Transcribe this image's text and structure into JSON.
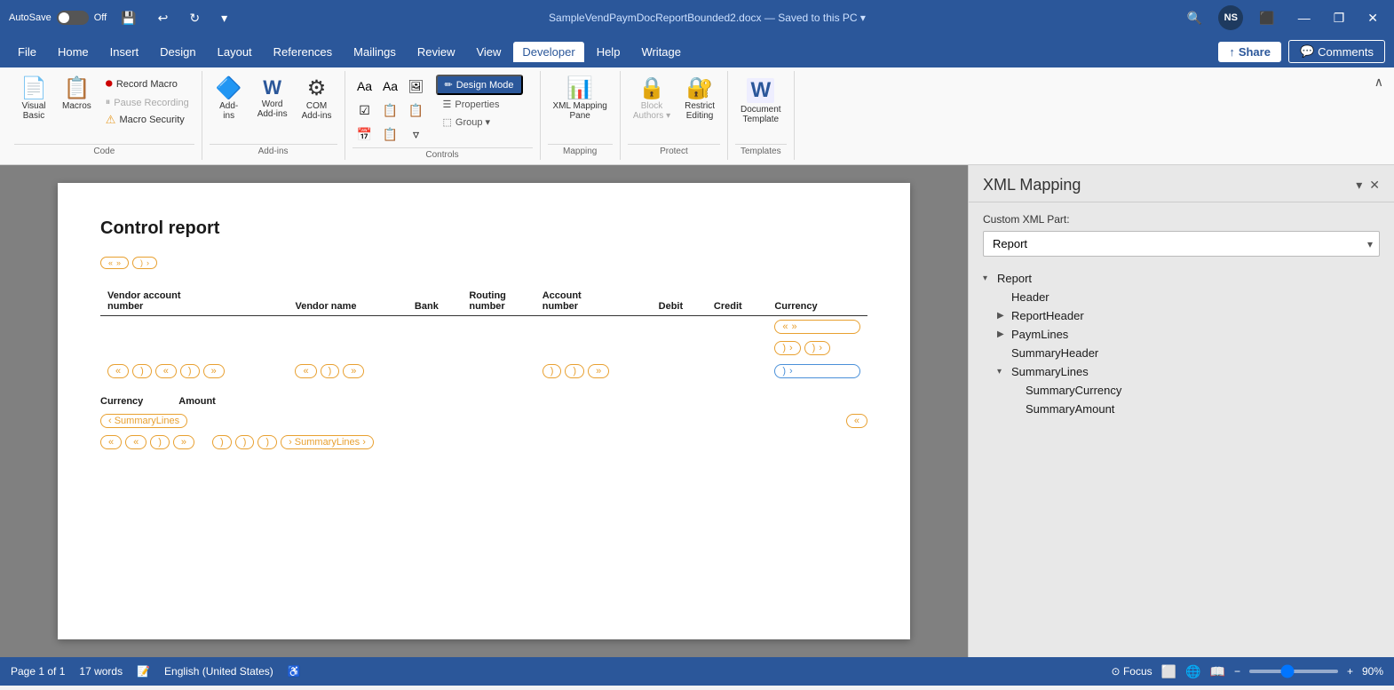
{
  "titlebar": {
    "autosave_label": "AutoSave",
    "autosave_state": "Off",
    "filename": "SampleVendPaymDocReportBounded2.docx",
    "save_status": "Saved to this PC",
    "avatar_initials": "NS",
    "minimize": "—",
    "restore": "❐",
    "close": "✕"
  },
  "menubar": {
    "items": [
      "File",
      "Home",
      "Insert",
      "Design",
      "Layout",
      "References",
      "Mailings",
      "Review",
      "View",
      "Developer",
      "Help",
      "Writage"
    ],
    "active": "Developer",
    "share_label": "Share",
    "comments_label": "Comments"
  },
  "ribbon": {
    "groups": [
      {
        "name": "Code",
        "items": [
          {
            "id": "visual-basic",
            "label": "Visual\nBasic",
            "icon": "📄"
          },
          {
            "id": "macros",
            "label": "Macros",
            "icon": "📋"
          },
          {
            "id": "record-macro",
            "label": "Record Macro"
          },
          {
            "id": "pause-recording",
            "label": "Pause Recording"
          },
          {
            "id": "macro-security",
            "label": "Macro Security"
          }
        ]
      },
      {
        "name": "Add-ins",
        "items": [
          {
            "id": "add-ins",
            "label": "Add-\nins",
            "icon": "🔷"
          },
          {
            "id": "word-add-ins",
            "label": "Word\nAdd-ins",
            "icon": "W"
          },
          {
            "id": "com-add-ins",
            "label": "COM\nAdd-ins",
            "icon": "⚙️"
          }
        ]
      },
      {
        "name": "Controls",
        "items": []
      },
      {
        "name": "Mapping",
        "items": [
          {
            "id": "xml-mapping-pane",
            "label": "XML Mapping\nPane",
            "icon": "📊"
          }
        ]
      },
      {
        "name": "Protect",
        "items": [
          {
            "id": "block-authors",
            "label": "Block\nAuthors",
            "icon": "🔒"
          },
          {
            "id": "restrict-editing",
            "label": "Restrict\nEditing",
            "icon": "🔐"
          }
        ]
      },
      {
        "name": "Templates",
        "items": [
          {
            "id": "document-template",
            "label": "Document\nTemplate",
            "icon": "W"
          }
        ]
      }
    ]
  },
  "document": {
    "title": "Control report",
    "table_headers": [
      "Vendor account\nnumber",
      "Vendor name",
      "Bank",
      "Routing\nnumber",
      "Account\nnumber",
      "Debit",
      "Credit",
      "Currency"
    ],
    "section_labels": [
      "Currency",
      "Amount"
    ],
    "summarylines_label": "SummaryLines"
  },
  "xml_panel": {
    "title": "XML Mapping",
    "custom_xml_label": "Custom XML Part:",
    "selected_part": "Report",
    "tree": [
      {
        "id": "report",
        "label": "Report",
        "level": 0,
        "arrow": "▾",
        "expanded": true
      },
      {
        "id": "header",
        "label": "Header",
        "level": 1,
        "arrow": "",
        "expanded": false
      },
      {
        "id": "reportheader",
        "label": "ReportHeader",
        "level": 1,
        "arrow": "▶",
        "expanded": false
      },
      {
        "id": "paymlines",
        "label": "PaymLines",
        "level": 1,
        "arrow": "▶",
        "expanded": false
      },
      {
        "id": "summaryheader",
        "label": "SummaryHeader",
        "level": 1,
        "arrow": "",
        "expanded": false
      },
      {
        "id": "summarylines",
        "label": "SummaryLines",
        "level": 1,
        "arrow": "▾",
        "expanded": true
      },
      {
        "id": "summarycurrency",
        "label": "SummaryCurrency",
        "level": 2,
        "arrow": "",
        "expanded": false
      },
      {
        "id": "summaryamount",
        "label": "SummaryAmount",
        "level": 2,
        "arrow": "",
        "expanded": false
      }
    ]
  },
  "statusbar": {
    "page_info": "Page 1 of 1",
    "word_count": "17 words",
    "language": "English (United States)",
    "focus_label": "Focus",
    "zoom_level": "90%"
  }
}
